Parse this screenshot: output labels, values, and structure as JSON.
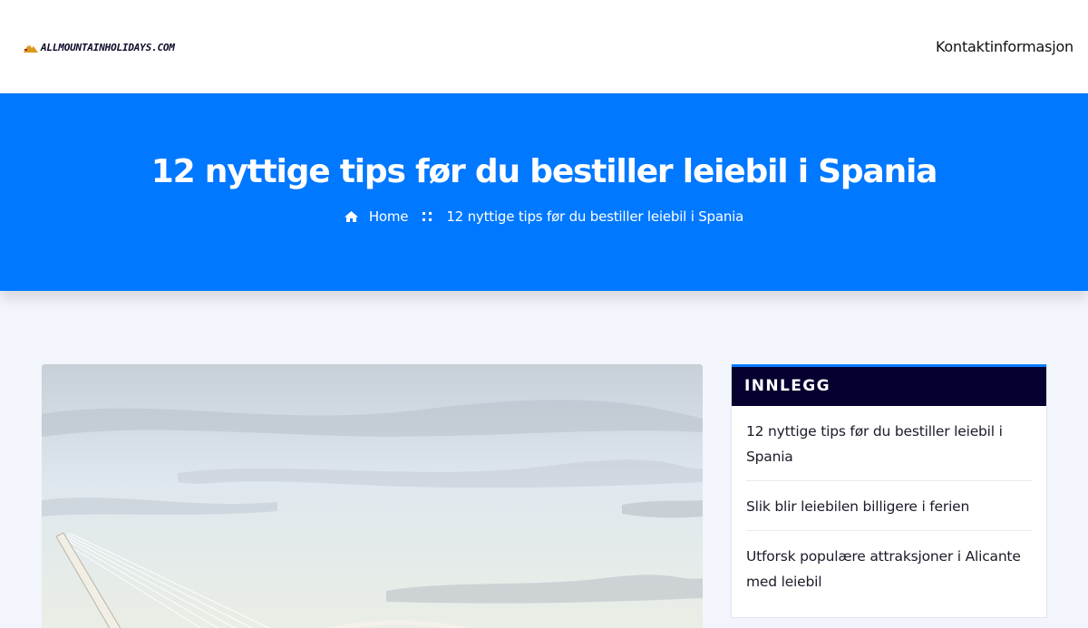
{
  "header": {
    "logo_text": "ALLMOUNTAINHOLIDAYS.COM",
    "nav_link": "Kontaktinformasjon"
  },
  "hero": {
    "title": "12 nyttige tips før du bestiller leiebil i Spania",
    "breadcrumb": {
      "home": "Home",
      "current": "12 nyttige tips før du bestiller leiebil i Spania"
    }
  },
  "sidebar": {
    "heading": "INNLEGG",
    "posts": [
      "12 nyttige tips før du bestiller leiebil i Spania",
      "Slik blir leiebilen billigere i ferien",
      "Utforsk populære attraksjoner i Alicante med leiebil"
    ]
  },
  "colors": {
    "accent": "#0078ff",
    "sidebar_heading_bg": "#04002f",
    "page_bg": "#f2f5fb"
  },
  "icons": [
    "mountain-logo-icon",
    "home-icon",
    "breadcrumb-separator-icon"
  ]
}
